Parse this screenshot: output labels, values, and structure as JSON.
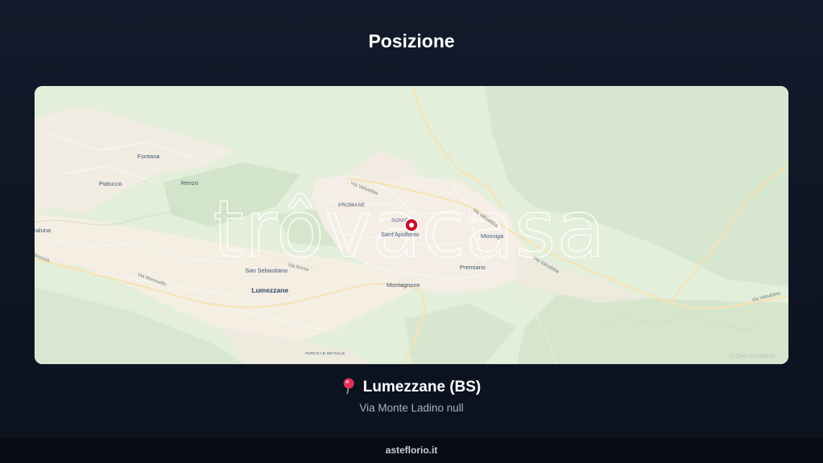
{
  "header": {
    "title": "Posizione"
  },
  "map": {
    "watermark": "trôvacasa",
    "attribution": "© OpenStreetMap",
    "marker": "location-marker-icon",
    "places": {
      "fontana": "Fontana",
      "piatucco": "Piatucco",
      "renzo": "Renzo",
      "zaluna": "zaluna",
      "promase": "PROMASE",
      "sonico": "SONIC",
      "sant_apollonio": "Sant'Apollonio",
      "mosniga": "Mosniga",
      "premiano": "Premiano",
      "san_sebastiano": "San Sebastiano",
      "lumezzane": "Lumezzane",
      "montagnone": "Montagnone",
      "parco": "PARCO LE BETULLE"
    },
    "roads": {
      "via_valsabbia_1": "Via Valsabbia",
      "via_valsabbia_2": "Via Valsabbia",
      "via_valsabbia_3": "Via Valsabbia",
      "via_valsabbia_4": "Via Valsabbia",
      "via_roma": "Via Roma",
      "via_monsuello": "Via Monsuello",
      "via_brescia": "Brescia"
    }
  },
  "location": {
    "city": "Lumezzane (BS)",
    "address": "Via Monte Ladino null"
  },
  "footer": {
    "site": "asteflorio.it"
  }
}
